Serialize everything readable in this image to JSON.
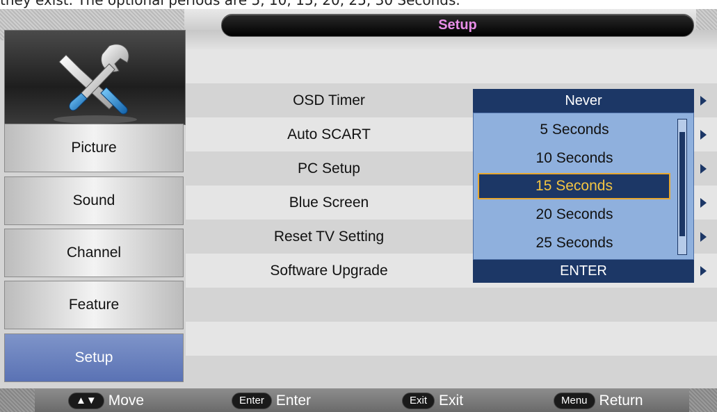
{
  "caption": "they exist. The optional periods are 5, 10, 15, 20, 25, 30 Seconds.",
  "header": {
    "title": "Setup"
  },
  "sidebar": {
    "items": [
      {
        "label": "Picture"
      },
      {
        "label": "Sound"
      },
      {
        "label": "Channel"
      },
      {
        "label": "Feature"
      },
      {
        "label": "Setup"
      }
    ],
    "active": "Setup"
  },
  "settings": {
    "rows": [
      {
        "label": "OSD Timer",
        "value": "Never"
      },
      {
        "label": "Auto SCART"
      },
      {
        "label": "PC Setup"
      },
      {
        "label": "Blue Screen"
      },
      {
        "label": "Reset TV Setting"
      },
      {
        "label": "Software Upgrade",
        "value": "ENTER"
      }
    ]
  },
  "dropdown": {
    "options": [
      "5 Seconds",
      "10 Seconds",
      "15 Seconds",
      "20 Seconds",
      "25 Seconds"
    ],
    "selected": "15 Seconds"
  },
  "footer": {
    "hints": [
      {
        "key": "▲▼",
        "label": "Move"
      },
      {
        "key": "Enter",
        "label": "Enter"
      },
      {
        "key": "Exit",
        "label": "Exit"
      },
      {
        "key": "Menu",
        "label": "Return"
      }
    ]
  },
  "colors": {
    "accent": "#1c3766",
    "highlight": "#f4c542",
    "title_text": "#e88ee8",
    "dropdown_bg": "#8fb0dd",
    "active_tab": "#5a72b4"
  }
}
